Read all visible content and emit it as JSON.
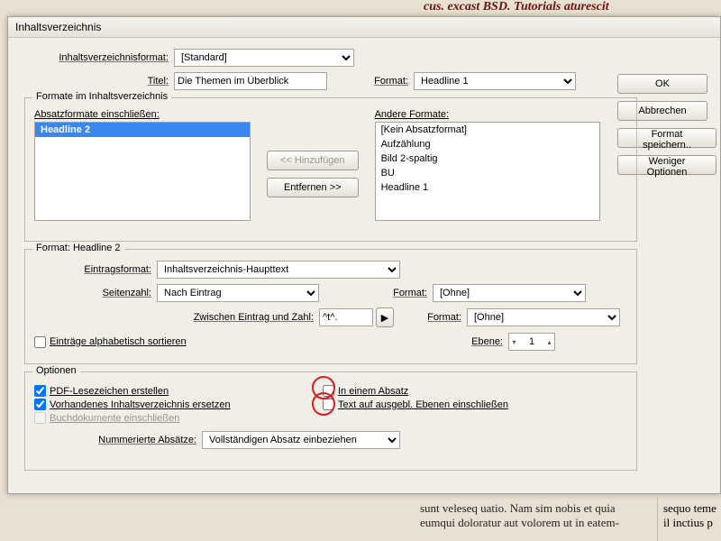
{
  "bg_header": "cus. excast BSD. Tutorials aturescit",
  "dialog": {
    "title": "Inhaltsverzeichnis",
    "format_label": "Inhaltsverzeichnisformat:",
    "format_value": "[Standard]",
    "title_label": "Titel:",
    "title_value": "Die Themen im Überblick",
    "title_format_label": "Format:",
    "title_format_value": "Headline 1",
    "group_formate": {
      "legend": "Formate im Inhaltsverzeichnis",
      "include_label": "Absatzformate einschließen:",
      "include_items": [
        "Headline 2"
      ],
      "other_label": "Andere Formate:",
      "other_items": [
        "[Kein Absatzformat]",
        "Aufzählung",
        "Bild 2-spaltig",
        "BU",
        "Headline 1"
      ],
      "btn_add": "<< Hinzufügen",
      "btn_remove": "Entfernen >>"
    },
    "group_style": {
      "legend": "Format: Headline 2",
      "entry_format_label": "Eintragsformat:",
      "entry_format_value": "Inhaltsverzeichnis-Haupttext",
      "pagenum_label": "Seitenzahl:",
      "pagenum_value": "Nach Eintrag",
      "between_label": "Zwischen Eintrag und Zahl:",
      "between_value": "^t^.",
      "between_btn": "▶",
      "format2_label": "Format:",
      "format2_value": "[Ohne]",
      "format3_label": "Format:",
      "format3_value": "[Ohne]",
      "sort_label": "Einträge alphabetisch sortieren",
      "level_label": "Ebene:",
      "level_value": "1"
    },
    "group_options": {
      "legend": "Optionen",
      "pdf": "PDF-Lesezeichen erstellen",
      "replace": "Vorhandenes Inhaltsverzeichnis ersetzen",
      "book": "Buchdokumente einschließen",
      "single_para": "In einem Absatz",
      "hidden_layers": "Text auf ausgebl. Ebenen einschließen",
      "numbered_label": "Nummerierte Absätze:",
      "numbered_value": "Vollständigen Absatz einbeziehen"
    },
    "buttons": {
      "ok": "OK",
      "cancel": "Abbrechen",
      "save_format": "Format speichern..",
      "fewer_options": "Weniger Optionen"
    }
  },
  "footer": {
    "col2a": "sunt veleseq uatio. Nam sim nobis et quia",
    "col2b": "eumqui doloratur aut volorem ut in eatem-",
    "col3a": "sequo teme",
    "col3b": "il inctius p"
  }
}
